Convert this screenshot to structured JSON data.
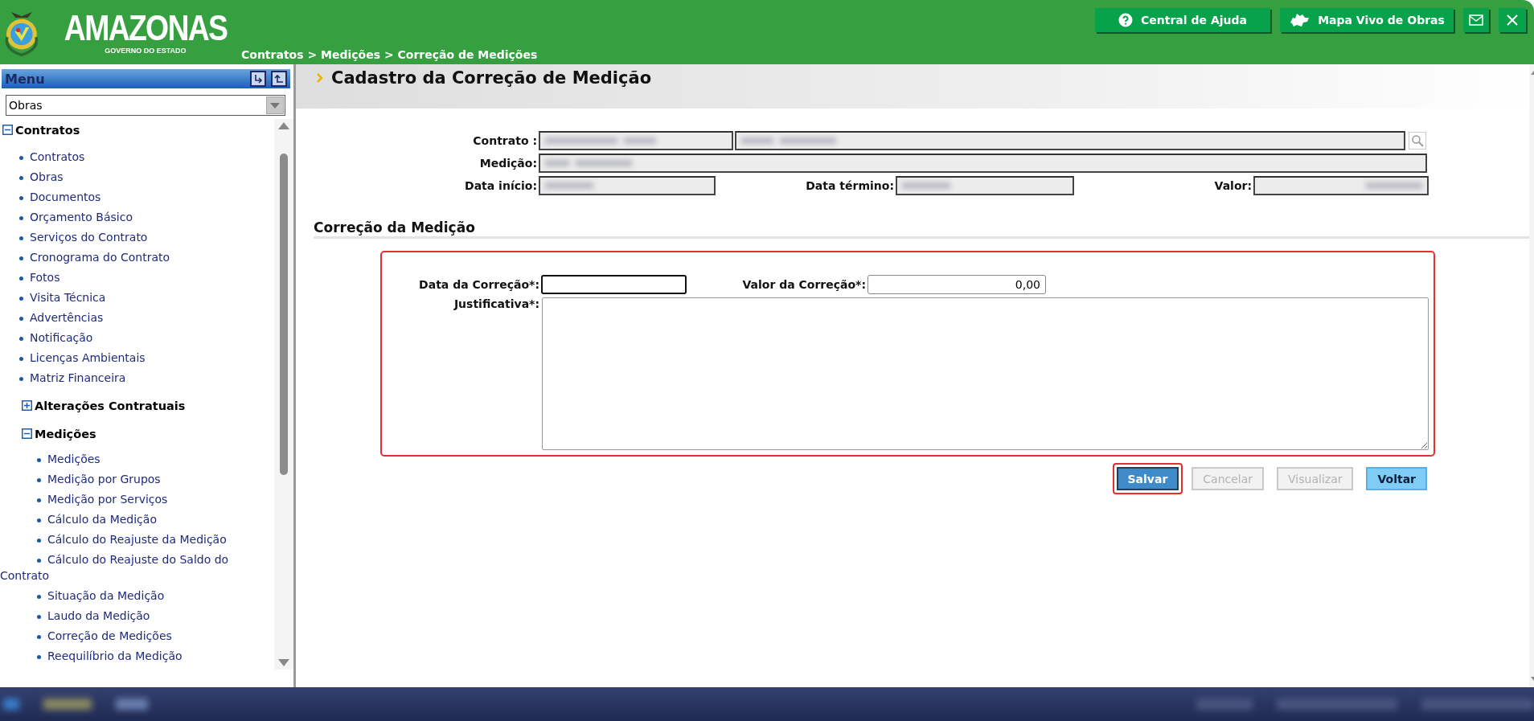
{
  "header": {
    "logo_title": "AMAZONAS",
    "logo_subtitle": "GOVERNO DO ESTADO",
    "breadcrumb": "Contratos > Medições > Correção de Medições",
    "buttons": [
      {
        "kind": "help",
        "label": "Central de Ajuda"
      },
      {
        "kind": "map",
        "label": "Mapa Vivo de Obras"
      },
      {
        "kind": "mail"
      },
      {
        "kind": "close"
      }
    ]
  },
  "sidebar": {
    "title": "Menu",
    "select_value": "Obras",
    "tree": [
      {
        "kind": "group",
        "label": "Contratos",
        "expanded": true,
        "children": [
          {
            "kind": "link",
            "label": "Contratos"
          },
          {
            "kind": "link",
            "label": "Obras"
          },
          {
            "kind": "link",
            "label": "Documentos"
          },
          {
            "kind": "link",
            "label": "Orçamento Básico"
          },
          {
            "kind": "link",
            "label": "Serviços do Contrato"
          },
          {
            "kind": "link",
            "label": "Cronograma do Contrato"
          },
          {
            "kind": "link",
            "label": "Fotos"
          },
          {
            "kind": "link",
            "label": "Visita Técnica"
          },
          {
            "kind": "link",
            "label": "Advertências"
          },
          {
            "kind": "link",
            "label": "Notificação"
          },
          {
            "kind": "link",
            "label": "Licenças Ambientais"
          },
          {
            "kind": "link",
            "label": "Matriz Financeira"
          },
          {
            "kind": "group",
            "label": "Alterações Contratuais",
            "expanded": false
          },
          {
            "kind": "group",
            "label": "Medições",
            "expanded": true,
            "children": [
              {
                "kind": "link",
                "label": "Medições"
              },
              {
                "kind": "link",
                "label": "Medição por Grupos"
              },
              {
                "kind": "link",
                "label": "Medição por Serviços"
              },
              {
                "kind": "link",
                "label": "Cálculo da Medição"
              },
              {
                "kind": "link",
                "label": "Cálculo do Reajuste da Medição"
              },
              {
                "kind": "link",
                "label": "Cálculo do Reajuste do Saldo do Contrato"
              },
              {
                "kind": "link",
                "label": "Situação da Medição"
              },
              {
                "kind": "link",
                "label": "Laudo da Medição"
              },
              {
                "kind": "link",
                "label": "Correção de Medições"
              },
              {
                "kind": "link",
                "label": "Reequilíbrio da Medição"
              }
            ]
          }
        ]
      }
    ]
  },
  "page": {
    "title": "Cadastro da Correção de Medição",
    "labels": {
      "contrato": "Contrato :",
      "medicao": "Medição:",
      "data_inicio": "Data início:",
      "data_termino": "Data término:",
      "valor": "Valor:"
    },
    "section_title": "Correção da Medição",
    "form": {
      "data_label": "Data da Correção*:",
      "data_focused": true,
      "valor_label": "Valor da Correção*:",
      "valor_value": "0,00",
      "justificativa_label": "Justificativa*:"
    },
    "buttons": [
      {
        "kind": "primary",
        "label": "Salvar",
        "disabled": false,
        "highlighted": true
      },
      {
        "kind": "secondary",
        "label": "Cancelar",
        "disabled": true,
        "highlighted": false
      },
      {
        "kind": "secondary",
        "label": "Visualizar",
        "disabled": true,
        "highlighted": false
      },
      {
        "kind": "light",
        "label": "Voltar",
        "disabled": false,
        "highlighted": false
      }
    ]
  }
}
